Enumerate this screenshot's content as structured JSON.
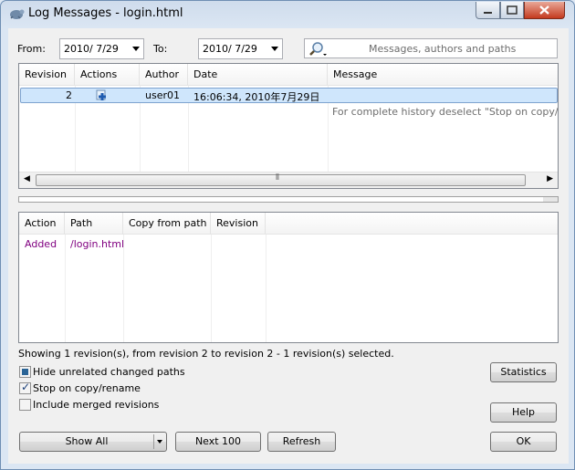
{
  "window": {
    "title": "Log Messages - login.html"
  },
  "filter": {
    "from_label": "From:",
    "from_value": "2010/  7/29",
    "to_label": "To:",
    "to_value": "2010/  7/29",
    "search_placeholder": "Messages, authors and paths"
  },
  "log_list": {
    "columns": [
      "Revision",
      "Actions",
      "Author",
      "Date",
      "Message"
    ],
    "rows": [
      {
        "revision": "2",
        "action_icon": "add-plus-icon",
        "author": "user01",
        "date": "16:06:34, 2010年7月29日",
        "message": ""
      }
    ],
    "hint": "For complete history deselect \"Stop on copy/renam"
  },
  "changed_paths": {
    "columns": [
      "Action",
      "Path",
      "Copy from path",
      "Revision"
    ],
    "rows": [
      {
        "action": "Added",
        "path": "/login.html",
        "copy_from": "",
        "revision": ""
      }
    ]
  },
  "status_text": "Showing 1 revision(s), from revision 2 to revision 2 - 1 revision(s) selected.",
  "options": {
    "hide_unrelated": {
      "label": "Hide unrelated changed paths",
      "checked": "indeterminate"
    },
    "stop_on_copy": {
      "label": "Stop on copy/rename",
      "checked": true
    },
    "include_merged": {
      "label": "Include merged revisions",
      "checked": false
    }
  },
  "buttons": {
    "statistics": "Statistics",
    "help": "Help",
    "show_all": "Show All",
    "next_100": "Next 100",
    "refresh": "Refresh",
    "ok": "OK"
  },
  "colors": {
    "selection": "#cde8ff",
    "added_text": "#800080",
    "hint_text": "#6d6d6d"
  }
}
